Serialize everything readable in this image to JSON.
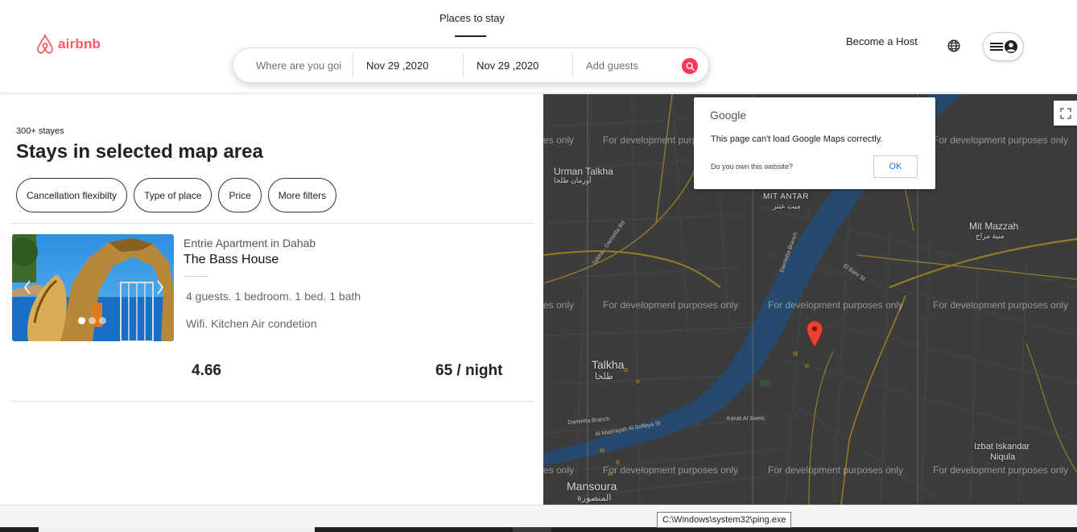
{
  "header": {
    "logo_text": "airbnb",
    "nav_tab": "Places to stay",
    "become_host": "Become a Host"
  },
  "search": {
    "where_placeholder": "Where are you goi",
    "checkin": "Nov 29 ,2020",
    "checkout": "Nov 29 ,2020",
    "guests_placeholder": "Add guests"
  },
  "listings": {
    "count": "300+ stayes",
    "title": "Stays in selected map area",
    "filters": [
      "Cancellation flexibilty",
      "Type of place",
      "Price",
      "More filters"
    ]
  },
  "card": {
    "subtitle": "Entrie Apartment in Dahab",
    "name": "The Bass House",
    "info": "4 guests. 1 bedroom. 1 bed. 1 bath",
    "amenities": "Wifi. Kitchen Air condetion",
    "rating": "4.66",
    "price": "65 / night"
  },
  "map": {
    "dev_text": "For development purposes only",
    "dev_text_short": "For development purp",
    "dev_text_tail": "es only",
    "places": {
      "mit_antar": "MIT ANTAR",
      "mit_mazzah": "Mit Mazzah",
      "urman_talkha": "Urman Talkha",
      "talkha": "Talkha",
      "mansoura": "Mansoura",
      "izbat": "Izbat Iskandar",
      "niqula": "Niqula"
    },
    "places_ar": {
      "mit_antar": "ميت عنتر",
      "mit_mazzah": "منية مزاح",
      "urman_talkha": "أورمان طلخا",
      "talkha": "طلخا",
      "mansoura": "المنصورة"
    },
    "streets": {
      "talkha_damietta": "Talkha - Damietta Rd",
      "damietta_branch": "Damietta Branch",
      "el_bahr": "El Bahr St",
      "kanat": "Kanat Al Sweis",
      "mashaya": "Al Mashayah Al Sofleya St"
    }
  },
  "dialog": {
    "brand": "Google",
    "message": "This page can't load Google Maps correctly.",
    "question": "Do you own this website?",
    "ok": "OK"
  },
  "tooltip": "C:\\Windows\\system32\\ping.exe",
  "colors": {
    "brand": "#ff5a5f",
    "search_button": "#ff385c",
    "map_water": "#2f5b86",
    "map_road": "#b8962e"
  }
}
